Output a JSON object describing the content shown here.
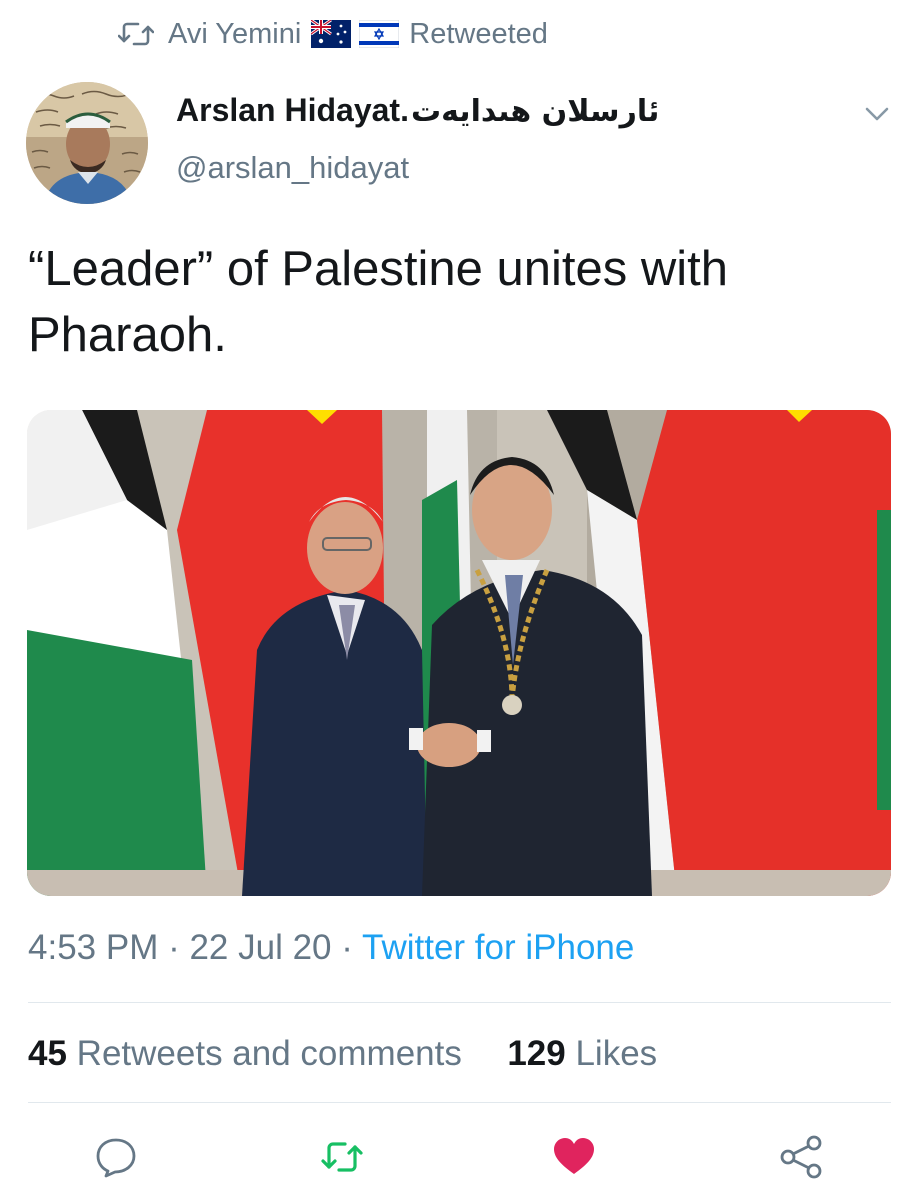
{
  "retweet_banner": {
    "icon": "retweet-icon",
    "user": "Avi Yemini",
    "flags": [
      "australia-flag-icon",
      "israel-flag-icon"
    ],
    "label": "Retweeted"
  },
  "author": {
    "avatar": "avatar",
    "name": "Arslan Hidayat.",
    "name_native": "ئارسلان ھىدايەت",
    "handle": "@arslan_hidayat",
    "menu_icon": "chevron-down-icon"
  },
  "tweet": {
    "text": "“Leader” of Palestine unites with Pharaoh.",
    "media": "photo"
  },
  "meta": {
    "time": "4:53 PM",
    "sep1": " · ",
    "date": "22 Jul 20",
    "sep2": " · ",
    "source": "Twitter for iPhone"
  },
  "stats": {
    "retweets_count": "45",
    "retweets_label": "Retweets and comments",
    "likes_count": "129",
    "likes_label": "Likes"
  },
  "actions": [
    {
      "icon": "reply-icon"
    },
    {
      "icon": "retweet-icon",
      "color": "#17bf63"
    },
    {
      "icon": "heart-icon",
      "color": "#e0245e"
    },
    {
      "icon": "share-icon"
    }
  ],
  "colors": {
    "secondary_text": "#657786",
    "link": "#1da1f2",
    "retweet_active": "#17bf63",
    "like_active": "#e0245e",
    "divider": "#e1e8ed"
  }
}
